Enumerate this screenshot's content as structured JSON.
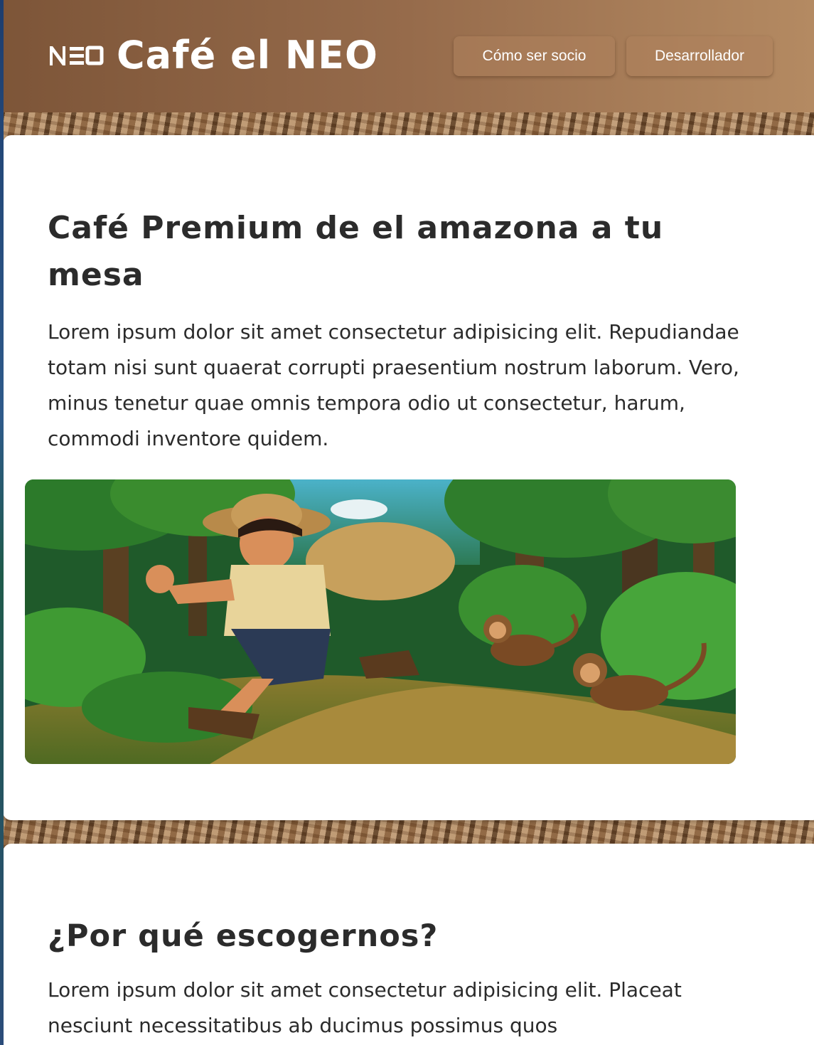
{
  "header": {
    "logo_text": "NEO",
    "title": "Café el NEO",
    "nav": [
      {
        "label": "Cómo ser socio"
      },
      {
        "label": "Desarrollador"
      }
    ]
  },
  "hero_section": {
    "heading": "Café Premium de el amazona a tu mesa",
    "body": "Lorem ipsum dolor sit amet consectetur adipisicing elit. Repudiandae totam nisi sunt quaerat corrupti praesentium nostrum laborum. Vero, minus tenetur quae omnis tempora odio ut consectetur, harum, commodi inventore quidem."
  },
  "why_section": {
    "heading": "¿Por qué escogernos?",
    "body": "Lorem ipsum dolor sit amet consectetur adipisicing elit. Placeat nesciunt necessitatibus ab ducimus possimus quos"
  },
  "colors": {
    "header_start": "#7d5538",
    "header_end": "#b48a62",
    "card_background": "#ffffff",
    "text": "#2b2b2b"
  }
}
